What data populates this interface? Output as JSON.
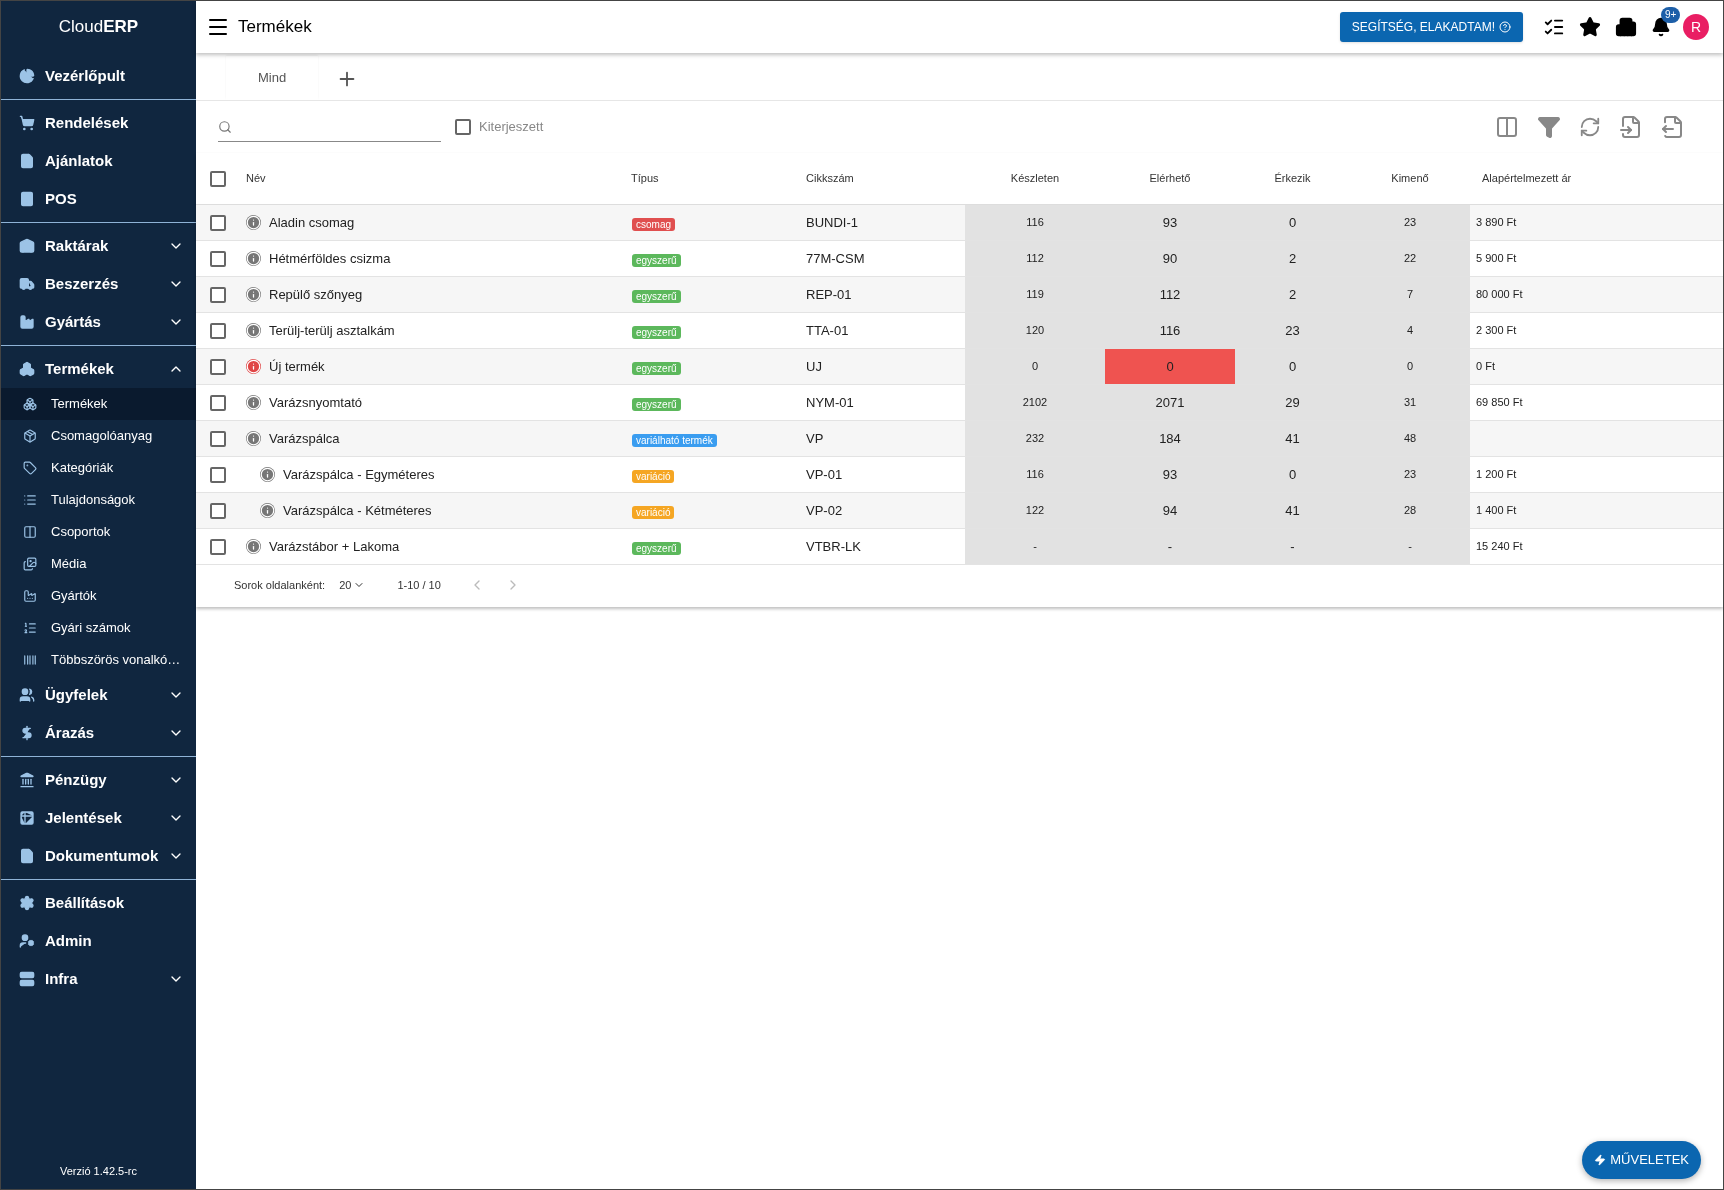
{
  "sidebar": {
    "logo": {
      "light": "Cloud",
      "bold": "ERP"
    },
    "groups": [
      [
        {
          "label": "Vezérlőpult"
        }
      ],
      [
        {
          "label": "Rendelések"
        },
        {
          "label": "Ajánlatok"
        },
        {
          "label": "POS"
        }
      ],
      [
        {
          "label": "Raktárak",
          "expanded": false
        },
        {
          "label": "Beszerzés",
          "expanded": false
        },
        {
          "label": "Gyártás",
          "expanded": false
        }
      ],
      [
        {
          "label": "Termékek",
          "expanded": true,
          "children": [
            {
              "label": "Termékek",
              "selected": true
            },
            {
              "label": "Csomagolóanyag",
              "selected": false
            },
            {
              "label": "Kategóriák",
              "selected": false
            },
            {
              "label": "Tulajdonságok",
              "selected": false
            },
            {
              "label": "Csoportok",
              "selected": false
            },
            {
              "label": "Média",
              "selected": false
            },
            {
              "label": "Gyártók",
              "selected": false
            },
            {
              "label": "Gyári számok",
              "selected": false
            },
            {
              "label": "Többszörös vonalkó…",
              "selected": false
            }
          ]
        },
        {
          "label": "Ügyfelek",
          "expanded": false
        },
        {
          "label": "Árazás",
          "expanded": false
        }
      ],
      [
        {
          "label": "Pénzügy",
          "expanded": false
        },
        {
          "label": "Jelentések",
          "expanded": false
        },
        {
          "label": "Dokumentumok",
          "expanded": false
        }
      ],
      [
        {
          "label": "Beállítások"
        },
        {
          "label": "Admin"
        },
        {
          "label": "Infra",
          "expanded": false
        }
      ]
    ],
    "version": "Verzió 1.42.5-rc"
  },
  "header": {
    "title": "Termékek",
    "help_button": "SEGÍTSÉG, ELAKADTAM!",
    "notification_badge": "9+",
    "avatar": "R"
  },
  "tabs": [
    {
      "label": "Mind",
      "selected": true
    }
  ],
  "toolbar": {
    "extended": {
      "label": "Kiterjeszett",
      "checked": false
    }
  },
  "table": {
    "columns": [
      "Név",
      "Típus",
      "Cikkszám",
      "Készleten",
      "Elérhető",
      "Érkezik",
      "Kimenő",
      "Alapértelmezett ár"
    ],
    "all_checked": false,
    "rows": [
      {
        "name": "Aladin csomag",
        "type": {
          "label": "csomag",
          "kind": "package"
        },
        "sku": "BUNDI-1",
        "stock": "116",
        "available": "93",
        "incoming": "0",
        "outgoing": "23",
        "price": "3 890 Ft",
        "checked": false,
        "warning": false
      },
      {
        "name": "Hétmérföldes csizma",
        "type": {
          "label": "egyszerű",
          "kind": "simple"
        },
        "sku": "77M-CSM",
        "stock": "112",
        "available": "90",
        "incoming": "2",
        "outgoing": "22",
        "price": "5 900 Ft",
        "checked": false,
        "warning": false
      },
      {
        "name": "Repülő szőnyeg",
        "type": {
          "label": "egyszerű",
          "kind": "simple"
        },
        "sku": "REP-01",
        "stock": "119",
        "available": "112",
        "incoming": "2",
        "outgoing": "7",
        "price": "80 000 Ft",
        "checked": false,
        "warning": false
      },
      {
        "name": "Terülj-terülj asztalkám",
        "type": {
          "label": "egyszerű",
          "kind": "simple"
        },
        "sku": "TTA-01",
        "stock": "120",
        "available": "116",
        "incoming": "23",
        "outgoing": "4",
        "price": "2 300 Ft",
        "checked": false,
        "warning": false
      },
      {
        "name": "Új termék",
        "type": {
          "label": "egyszerű",
          "kind": "simple"
        },
        "sku": "UJ",
        "stock": "0",
        "available": "0",
        "incoming": "0",
        "outgoing": "0",
        "price": "0 Ft",
        "checked": false,
        "warning": true
      },
      {
        "name": "Varázsnyomtató",
        "type": {
          "label": "egyszerű",
          "kind": "simple"
        },
        "sku": "NYM-01",
        "stock": "2102",
        "available": "2071",
        "incoming": "29",
        "outgoing": "31",
        "price": "69 850 Ft",
        "checked": false,
        "warning": false
      },
      {
        "name": "Varázspálca",
        "type": {
          "label": "variálható termék",
          "kind": "variable"
        },
        "sku": "VP",
        "stock": "232",
        "available": "184",
        "incoming": "41",
        "outgoing": "48",
        "checked": false,
        "warning": false,
        "children": [
          {
            "name": "Varázspálca - Egyméteres",
            "type": {
              "label": "variáció",
              "kind": "variation"
            },
            "sku": "VP-01",
            "stock": "116",
            "available": "93",
            "incoming": "0",
            "outgoing": "23",
            "price": "1 200 Ft",
            "checked": false,
            "warning": false
          },
          {
            "name": "Varázspálca - Kétméteres",
            "type": {
              "label": "variáció",
              "kind": "variation"
            },
            "sku": "VP-02",
            "stock": "122",
            "available": "94",
            "incoming": "41",
            "outgoing": "28",
            "price": "1 400 Ft",
            "checked": false,
            "warning": false
          }
        ]
      },
      {
        "name": "Varázstábor + Lakoma",
        "type": {
          "label": "egyszerű",
          "kind": "simple"
        },
        "sku": "VTBR-LK",
        "stock": "-",
        "available": "-",
        "incoming": "-",
        "outgoing": "-",
        "price": "15 240 Ft",
        "checked": false,
        "warning": false
      }
    ]
  },
  "pagination": {
    "label": "Sorok oldalanként:",
    "per_page": "20",
    "range": "1-10 / 10"
  },
  "fab": "MŰVELETEK"
}
